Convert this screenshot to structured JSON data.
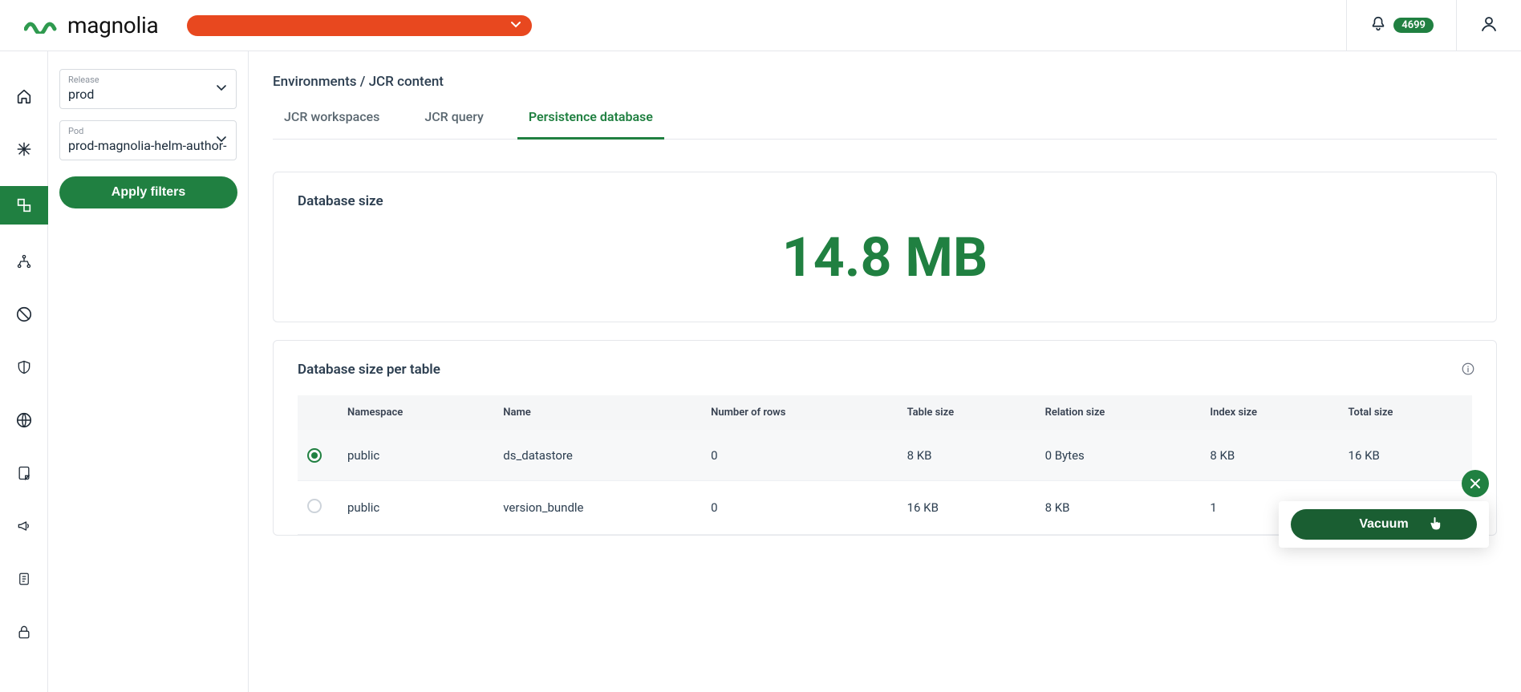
{
  "brand": {
    "name": "magnolia"
  },
  "notifications": {
    "count": "4699"
  },
  "filters": {
    "release_label": "Release",
    "release_value": "prod",
    "pod_label": "Pod",
    "pod_value": "prod-magnolia-helm-author-",
    "apply": "Apply filters"
  },
  "breadcrumb": "Environments / JCR content",
  "tabs": [
    {
      "label": "JCR workspaces",
      "active": false
    },
    {
      "label": "JCR query",
      "active": false
    },
    {
      "label": "Persistence database",
      "active": true
    }
  ],
  "db_size_title": "Database size",
  "db_size_value": "14.8 MB",
  "per_table_title": "Database size per table",
  "columns": {
    "namespace": "Namespace",
    "name": "Name",
    "rows": "Number of rows",
    "table_size": "Table size",
    "relation_size": "Relation size",
    "index_size": "Index size",
    "total_size": "Total size"
  },
  "rows": [
    {
      "selected": true,
      "namespace": "public",
      "name": "ds_datastore",
      "rows": "0",
      "table_size": "8 KB",
      "relation_size": "0 Bytes",
      "index_size": "8 KB",
      "total_size": "16 KB"
    },
    {
      "selected": false,
      "namespace": "public",
      "name": "version_bundle",
      "rows": "0",
      "table_size": "16 KB",
      "relation_size": "8 KB",
      "index_size": "1",
      "total_size": ""
    }
  ],
  "vacuum_label": "Vacuum"
}
